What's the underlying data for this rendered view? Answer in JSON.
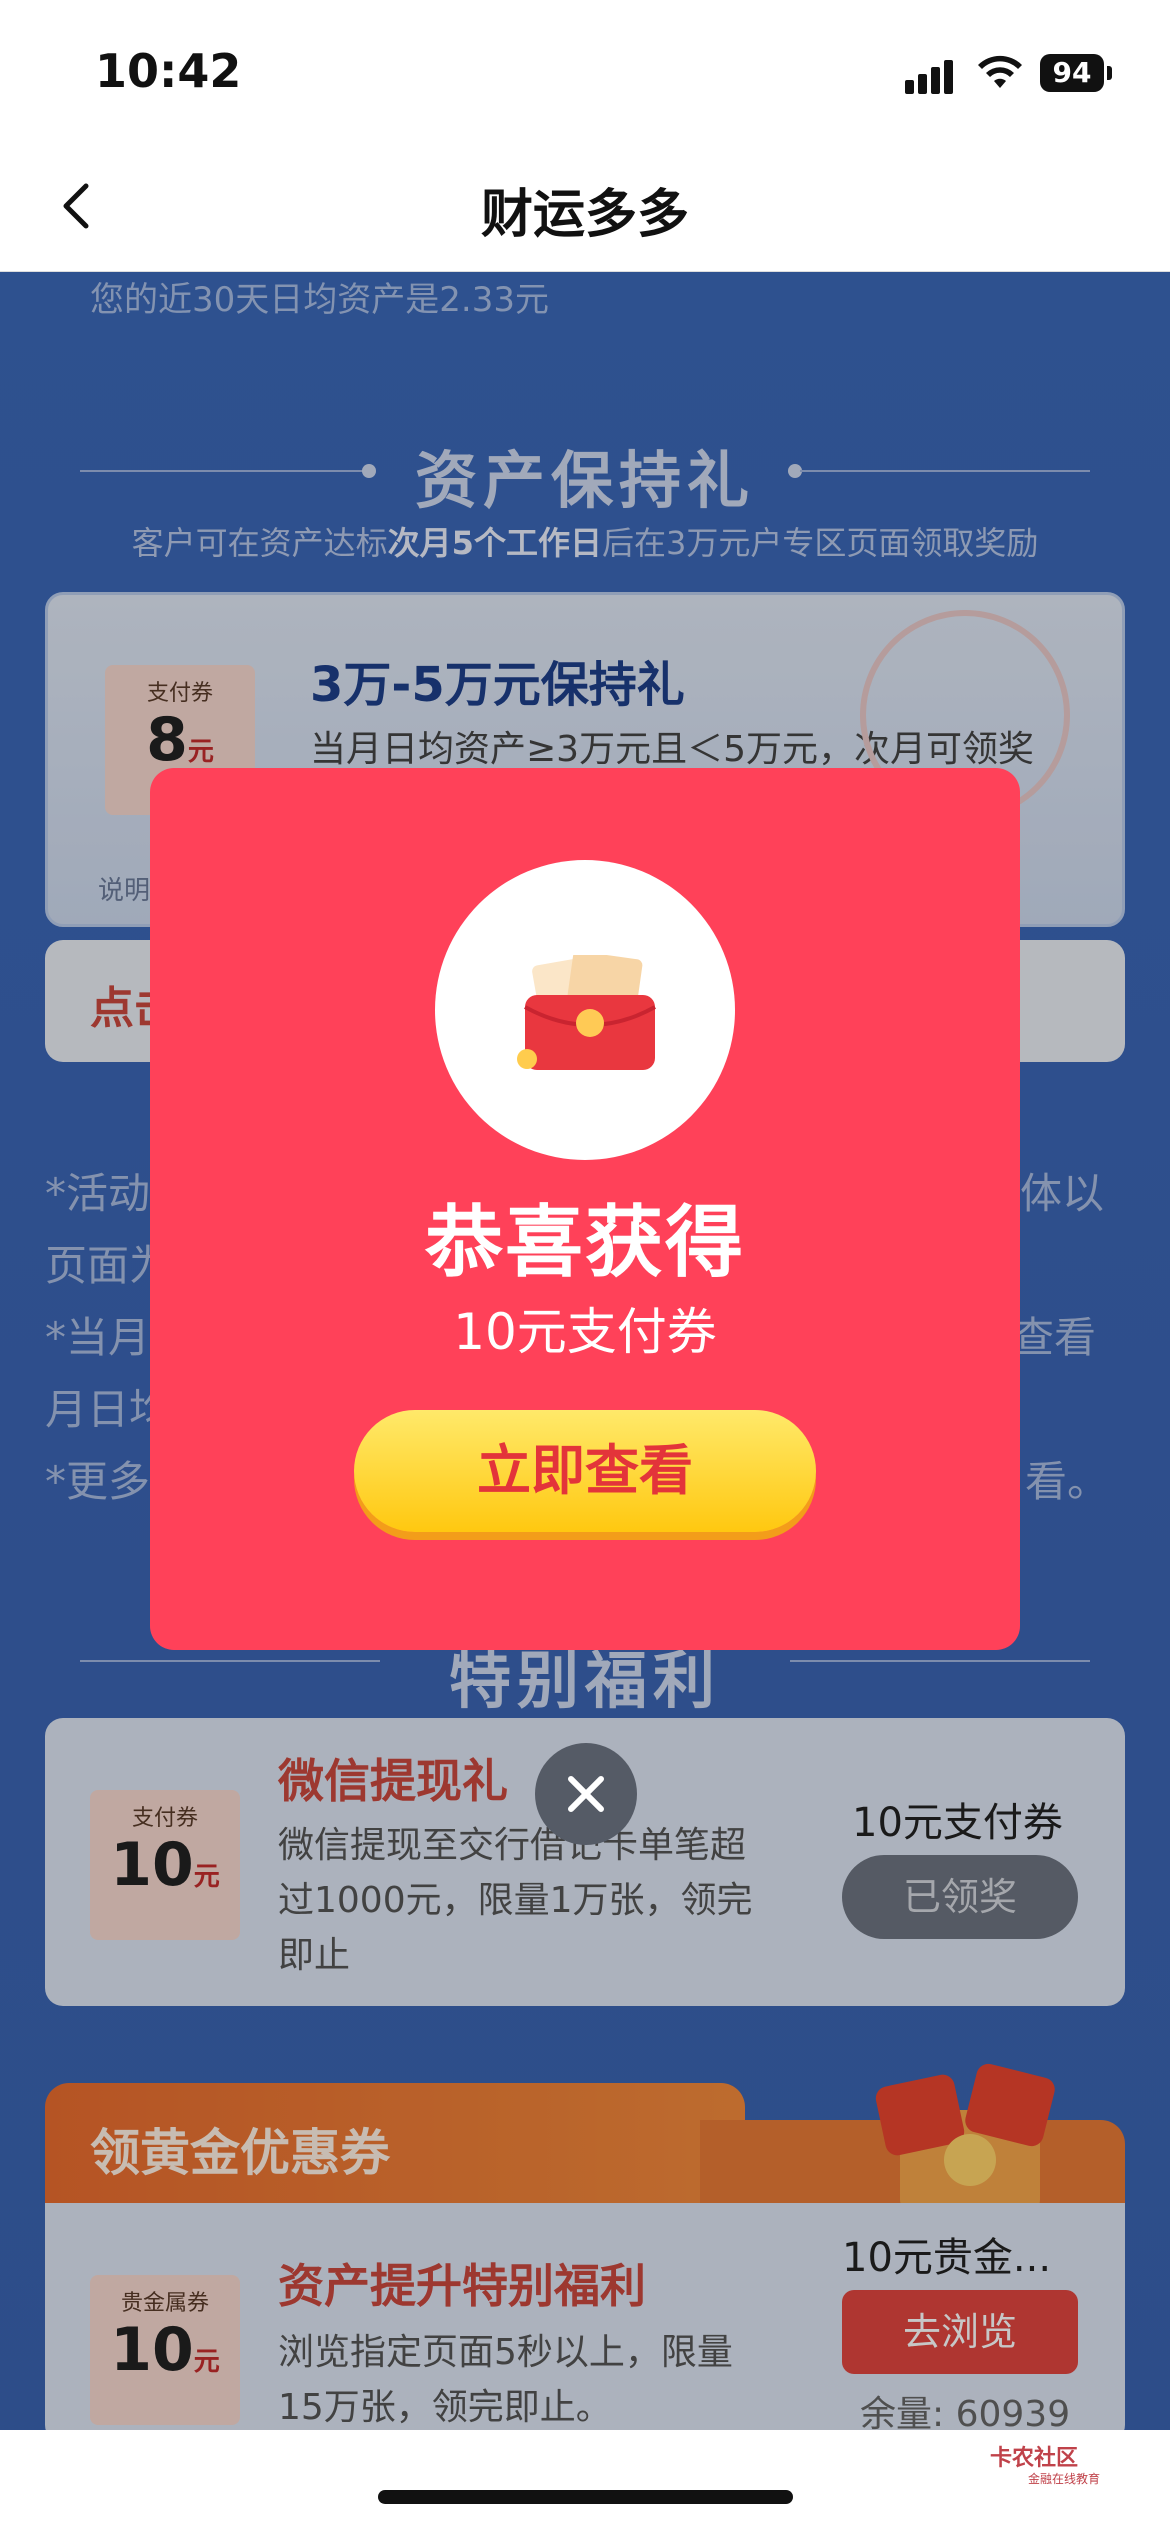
{
  "status_bar": {
    "time": "10:42",
    "battery": "94"
  },
  "nav": {
    "title": "财运多多"
  },
  "background": {
    "asset_line": "您的近30天日均资产是2.33元",
    "hold_section": {
      "title": "资产保持礼",
      "subtitle_pre": "客户可在资产达标",
      "subtitle_bold": "次月5个工作日",
      "subtitle_post": "后在3万元户专区页面领取奖励",
      "card_title": "3万-5万元保持礼",
      "card_desc": "当月日均资产≥3万元且＜5万元，次月可领奖",
      "voucher_label": "支付券",
      "voucher_amount": "8",
      "voucher_unit": "元",
      "note": "说明",
      "bar_text": "点击"
    },
    "rules": [
      "*活动",
      "页面为",
      "*当月",
      "月日均",
      "*更多"
    ],
    "rules_right": [
      "体以",
      "查看",
      "看。"
    ],
    "special_section": {
      "title": "特别福利",
      "wx_title": "微信提现礼",
      "wx_desc": "微信提现至交行借记卡单笔超过1000元，限量1万张，领完即止",
      "wx_prize": "10元支付券",
      "wx_button": "已领奖",
      "wx_voucher_label": "支付券",
      "wx_voucher_amount": "10",
      "wx_voucher_unit": "元"
    },
    "gold_section": {
      "header": "领黄金优惠券",
      "title": "资产提升特别福利",
      "desc": "浏览指定页面5秒以上，限量15万张，领完即止。",
      "prize": "10元贵金...",
      "button": "去浏览",
      "remaining": "余量: 60939",
      "voucher_label": "贵金属券",
      "voucher_amount": "10",
      "voucher_unit": "元"
    }
  },
  "modal": {
    "title": "恭喜获得",
    "subtitle": "10元支付券",
    "button": "立即查看"
  },
  "watermark": {
    "name": "卡农社区",
    "sub": "金融在线教育"
  },
  "colors": {
    "modal_bg": "#ff4159",
    "button_yellow": "#ffd93a",
    "page_blue": "#3a64b3"
  }
}
